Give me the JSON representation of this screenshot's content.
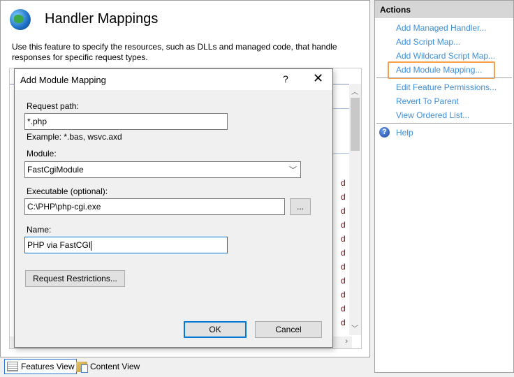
{
  "header": {
    "title": "Handler Mappings",
    "description": "Use this feature to specify the resources, such as DLLs and managed code, that handle responses for specific request types."
  },
  "background_list": {
    "partial_letters": [
      "d",
      "d",
      "d",
      "d",
      "d",
      "d",
      "d",
      "d",
      "d",
      "d",
      "d"
    ]
  },
  "views": {
    "features": "Features View",
    "content": "Content View"
  },
  "actions": {
    "title": "Actions",
    "items": [
      "Add Managed Handler...",
      "Add Script Map...",
      "Add Wildcard Script Map...",
      "Add Module Mapping...",
      "Edit Feature Permissions...",
      "Revert To Parent",
      "View Ordered List..."
    ],
    "help": "Help",
    "highlight_color": "#f5a04a"
  },
  "dialog": {
    "title": "Add Module Mapping",
    "help": "?",
    "close": "✕",
    "request_path_label": "Request path:",
    "request_path": "*.php",
    "example": "Example: *.bas, wsvc.axd",
    "module_label": "Module:",
    "module": "FastCgiModule",
    "executable_label": "Executable (optional):",
    "executable": "C:\\PHP\\php-cgi.exe",
    "browse": "...",
    "name_label": "Name:",
    "name": "PHP via FastCGI",
    "restrictions": "Request Restrictions...",
    "ok": "OK",
    "cancel": "Cancel"
  }
}
